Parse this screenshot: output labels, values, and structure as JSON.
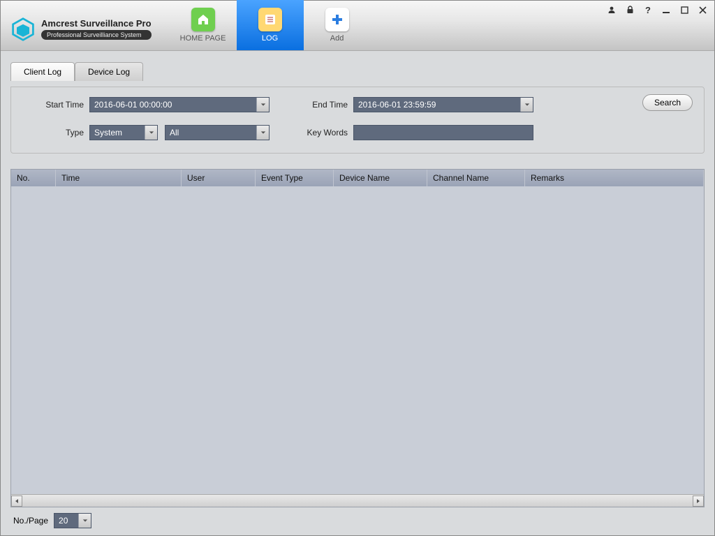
{
  "brand": {
    "title": "Amcrest Surveillance Pro",
    "subtitle": "Professional Surveilliance System"
  },
  "nav": [
    {
      "label": "HOME PAGE",
      "icon": "home",
      "active": false
    },
    {
      "label": "LOG",
      "icon": "log",
      "active": true
    },
    {
      "label": "Add",
      "icon": "add",
      "active": false
    }
  ],
  "subtabs": {
    "client": "Client Log",
    "device": "Device Log",
    "active": "client"
  },
  "filters": {
    "start_time_label": "Start Time",
    "start_time_value": "2016-06-01 00:00:00",
    "end_time_label": "End Time",
    "end_time_value": "2016-06-01 23:59:59",
    "type_label": "Type",
    "type_value": "System",
    "type_sub_value": "All",
    "keywords_label": "Key Words",
    "keywords_value": ""
  },
  "search_button": "Search",
  "table": {
    "columns": [
      "No.",
      "Time",
      "User",
      "Event Type",
      "Device Name",
      "Channel Name",
      "Remarks"
    ],
    "rows": []
  },
  "pager": {
    "label": "No./Page",
    "value": "20"
  }
}
